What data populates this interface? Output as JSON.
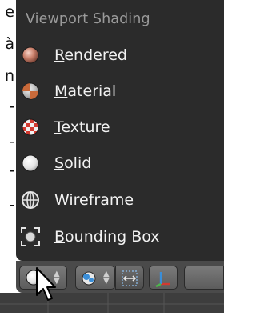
{
  "edge_chars": [
    "e",
    "à",
    "n",
    "-",
    "-",
    "-",
    "-"
  ],
  "menu": {
    "title": "Viewport Shading",
    "items": [
      {
        "label": "Rendered",
        "icon": "rendered-icon"
      },
      {
        "label": "Material",
        "icon": "material-icon"
      },
      {
        "label": "Texture",
        "icon": "texture-icon"
      },
      {
        "label": "Solid",
        "icon": "solid-icon"
      },
      {
        "label": "Wireframe",
        "icon": "wireframe-icon"
      },
      {
        "label": "Bounding Box",
        "icon": "bounding-box-icon"
      }
    ]
  },
  "header": {
    "buttons": [
      "viewport-shading-dropdown",
      "pivot-point-dropdown",
      "manipulator-toggle",
      "transform-gizmo"
    ]
  },
  "colors": {
    "menu_bg": "#2b2b2b",
    "title": "#9a9a9a",
    "label": "#f2f2f2",
    "header_bg": "#4a4a4a"
  }
}
